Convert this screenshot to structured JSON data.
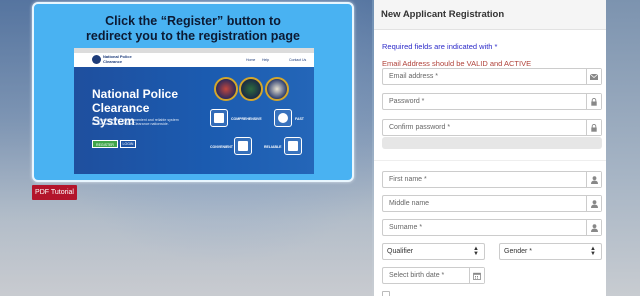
{
  "tutorial": {
    "title_line1": "Click the “Register” button to",
    "title_line2": "redirect you to the registration page",
    "screenshot": {
      "logo_text": "National Police Clearance",
      "nav": [
        "Home",
        "Help",
        "Contact Us"
      ],
      "hero_title_line1": "National Police",
      "hero_title_line2": "Clearance System",
      "hero_subtitle": "A comprehensive, fast, convenient and reliable system for the issuance of Police Clearance nationwide.",
      "register_label": "REGISTER",
      "login_label": "LOGIN",
      "features": [
        "COMPREHENSIVE",
        "FAST",
        "CONVENIENT",
        "RELIABLE"
      ]
    }
  },
  "pdf_button_label": "PDF Tutorial",
  "registration": {
    "title": "New Applicant Registration",
    "required_note": "Required fields are indicated with *",
    "email_note": "Email Address should be VALID and ACTIVE",
    "fields": {
      "email": "Email address *",
      "password": "Password *",
      "confirm_password": "Confirm password *",
      "first_name": "First name *",
      "middle_name": "Middle name",
      "surname": "Surname *",
      "qualifier": "Qualifier",
      "gender": "Gender *",
      "birth_date": "Select birth date *"
    }
  },
  "colors": {
    "card_bg": "#49b2f2",
    "pdf_button": "#b3142b",
    "required_note": "#2d2bc9",
    "email_note": "#b0423a"
  },
  "icons": [
    "envelope-icon",
    "lock-icon",
    "user-icon",
    "calendar-icon",
    "select-caret-icon"
  ]
}
